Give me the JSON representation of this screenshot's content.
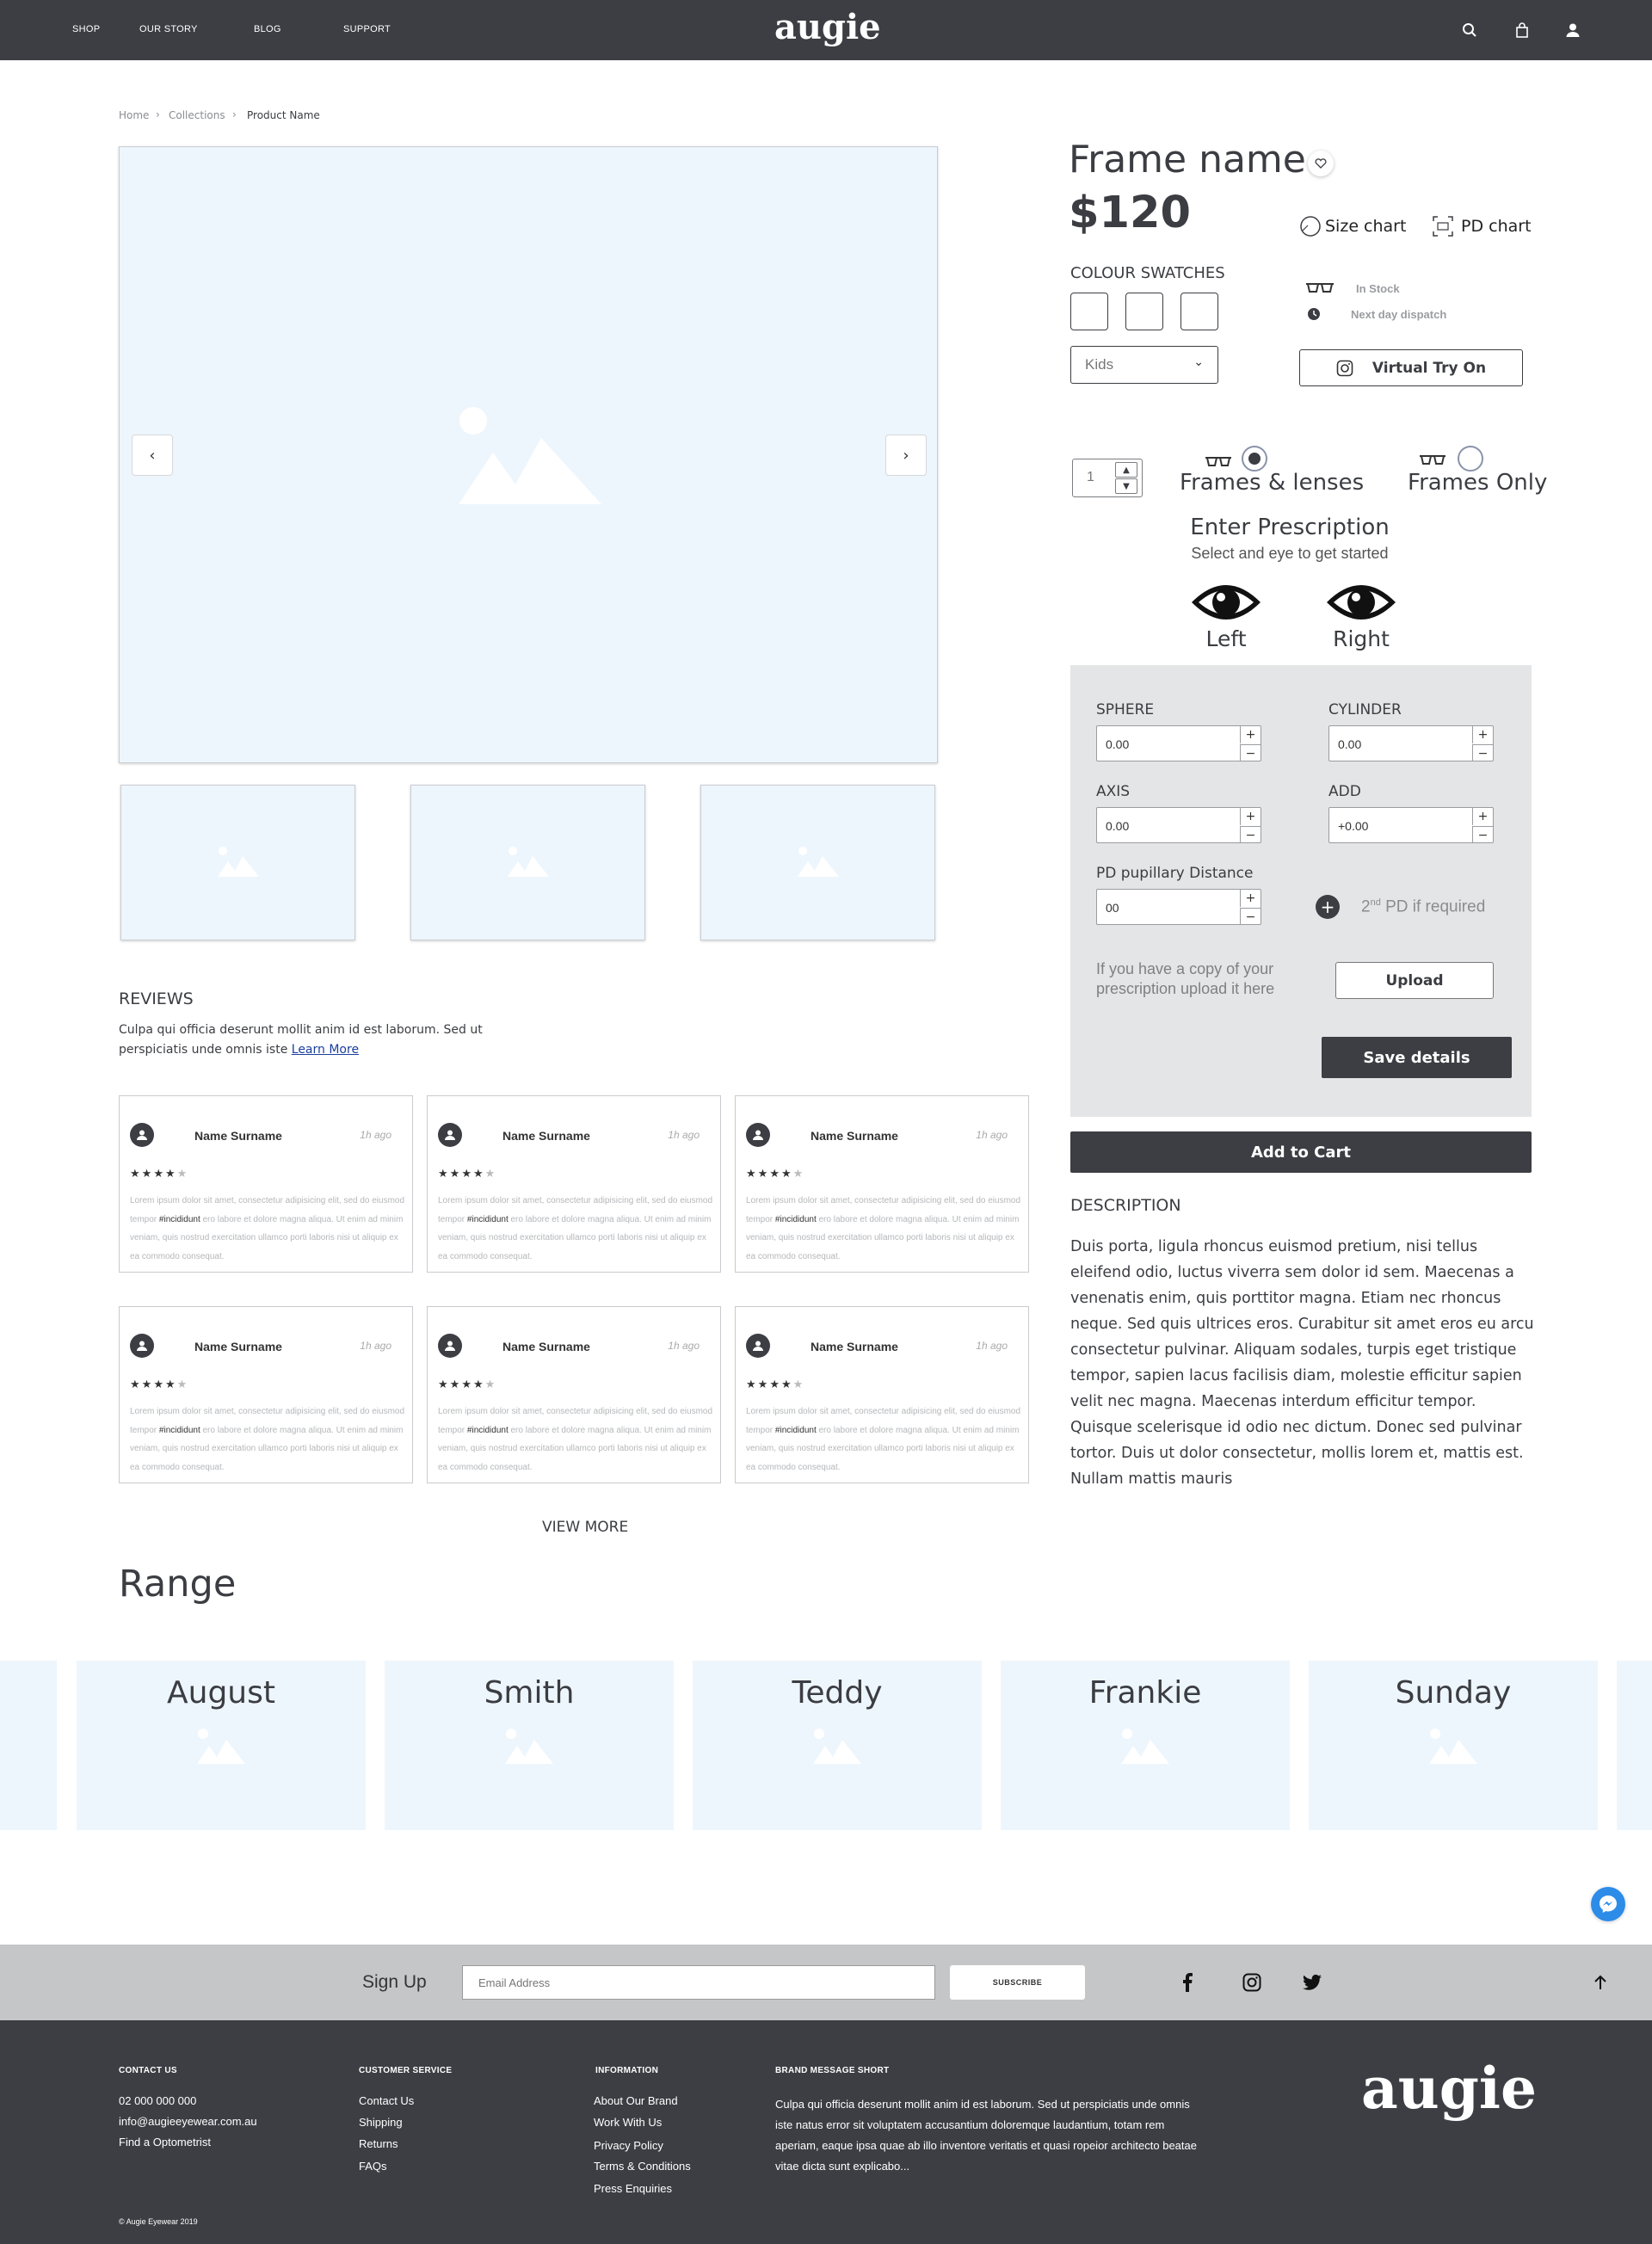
{
  "header": {
    "nav": [
      "SHOP",
      "OUR STORY",
      "BLOG",
      "SUPPORT"
    ],
    "logo": "augie"
  },
  "breadcrumb": [
    "Home",
    "Collections",
    "Product Name"
  ],
  "product": {
    "name": "Frame name",
    "price": "$120",
    "size_chart": "Size chart",
    "pd_chart": "PD chart",
    "swatches_label": "COLOUR SWATCHES",
    "in_stock": "In Stock",
    "dispatch": "Next day dispatch",
    "size_select": "Kids",
    "virtual_try_on": "Virtual Try On",
    "quantity": "1",
    "option_frames_lenses": "Frames & lenses",
    "option_frames_only": "Frames Only",
    "selected_option": "Frames & lenses"
  },
  "prescription": {
    "title": "Enter Prescription",
    "subtitle": "Select and eye to get started",
    "eye_left": "Left",
    "eye_right": "Right",
    "sphere_label": "SPHERE",
    "sphere_value": "0.00",
    "cylinder_label": "CYLINDER",
    "cylinder_value": "0.00",
    "axis_label": "AXIS",
    "axis_value": "0.00",
    "add_label": "ADD",
    "add_value": "+0.00",
    "pd_label": "PD pupillary Distance",
    "pd_value": "00",
    "second_pd_sup": "nd",
    "second_pd_pre": "2",
    "second_pd_text": "PD if required",
    "upload_text": "If you have a copy of your prescription upload it here",
    "upload_button": "Upload",
    "save_button": "Save details",
    "add_to_cart": "Add to Cart"
  },
  "description": {
    "heading": "DESCRIPTION",
    "body": "Duis porta, ligula rhoncus euismod pretium, nisi tellus eleifend odio, luctus viverra sem dolor id sem. Maecenas a venenatis enim, quis porttitor magna. Etiam nec rhoncus neque. Sed quis ultrices eros. Curabitur sit amet eros eu arcu consectetur pulvinar. Aliquam sodales, turpis eget tristique tempor, sapien lacus facilisis diam, molestie efficitur sapien velit nec magna. Maecenas interdum efficitur tempor. Quisque scelerisque id odio nec dictum. Donec sed pulvinar tortor. Duis ut dolor consectetur, mollis lorem et, mattis est. Nullam mattis mauris"
  },
  "reviews": {
    "heading": "REVIEWS",
    "intro": "Culpa qui officia deserunt mollit anim id est laborum. Sed ut perspiciatis unde omnis iste",
    "learn_more": "Learn More",
    "view_more": "VIEW MORE",
    "items": [
      {
        "name": "Name Surname",
        "time": "1h ago",
        "stars": 4,
        "body_a": "Lorem ipsum dolor sit amet, consectetur adipisicing elit, sed do eiusmod tempor ",
        "tag": "#incididunt",
        "body_b": " ero labore et dolore magna aliqua. Ut enim ad minim veniam, quis nostrud exercitation ullamco porti laboris nisi ut aliquip ex ea commodo consequat."
      },
      {
        "name": "Name Surname",
        "time": "1h ago",
        "stars": 4,
        "body_a": "Lorem ipsum dolor sit amet, consectetur adipisicing elit, sed do eiusmod tempor ",
        "tag": "#incididunt",
        "body_b": " ero labore et dolore magna aliqua. Ut enim ad minim veniam, quis nostrud exercitation ullamco porti laboris nisi ut aliquip ex ea commodo consequat."
      },
      {
        "name": "Name Surname",
        "time": "1h ago",
        "stars": 4,
        "body_a": "Lorem ipsum dolor sit amet, consectetur adipisicing elit, sed do eiusmod tempor ",
        "tag": "#incididunt",
        "body_b": " ero labore et dolore magna aliqua. Ut enim ad minim veniam, quis nostrud exercitation ullamco porti laboris nisi ut aliquip ex ea commodo consequat."
      },
      {
        "name": "Name Surname",
        "time": "1h ago",
        "stars": 4,
        "body_a": "Lorem ipsum dolor sit amet, consectetur adipisicing elit, sed do eiusmod tempor ",
        "tag": "#incididunt",
        "body_b": " ero labore et dolore magna aliqua. Ut enim ad minim veniam, quis nostrud exercitation ullamco porti laboris nisi ut aliquip ex ea commodo consequat."
      },
      {
        "name": "Name Surname",
        "time": "1h ago",
        "stars": 4,
        "body_a": "Lorem ipsum dolor sit amet, consectetur adipisicing elit, sed do eiusmod tempor ",
        "tag": "#incididunt",
        "body_b": " ero labore et dolore magna aliqua. Ut enim ad minim veniam, quis nostrud exercitation ullamco porti laboris nisi ut aliquip ex ea commodo consequat."
      },
      {
        "name": "Name Surname",
        "time": "1h ago",
        "stars": 4,
        "body_a": "Lorem ipsum dolor sit amet, consectetur adipisicing elit, sed do eiusmod tempor ",
        "tag": "#incididunt",
        "body_b": " ero labore et dolore magna aliqua. Ut enim ad minim veniam, quis nostrud exercitation ullamco porti laboris nisi ut aliquip ex ea commodo consequat."
      }
    ]
  },
  "range": {
    "heading": "Range",
    "items": [
      "August",
      "Smith",
      "Teddy",
      "Frankie",
      "Sunday"
    ]
  },
  "signup": {
    "label": "Sign Up",
    "placeholder": "Email Address",
    "button": "SUBSCRIBE"
  },
  "footer": {
    "contact_head": "CONTACT US",
    "contact": [
      "02 000 000 000",
      "info@augieeyewear.com.au",
      "Find a Optometrist"
    ],
    "service_head": "CUSTOMER SERVICE",
    "service": [
      "Contact Us",
      "Shipping",
      "Returns",
      "FAQs"
    ],
    "info_head": "INFORMATION",
    "info": [
      "About Our Brand",
      "Work With Us",
      "Privacy Policy",
      "Terms & Conditions",
      "Press Enquiries"
    ],
    "brand_head": "BRAND MESSAGE SHORT",
    "brand_text": "Culpa qui officia deserunt mollit anim id est laborum. Sed ut perspiciatis unde omnis iste natus error sit voluptatem accusantium doloremque laudantium, totam rem aperiam, eaque ipsa quae ab illo inventore veritatis et quasi ropeior architecto beatae vitae dicta sunt explicabo...",
    "logo": "augie",
    "copyright": "© Augie Eyewear 2019"
  },
  "colors": {
    "dark": "#3c3e43",
    "placeholder_bg": "#eef6fd",
    "panel_bg": "#e4e5e6",
    "messenger": "#2d8ce8"
  }
}
